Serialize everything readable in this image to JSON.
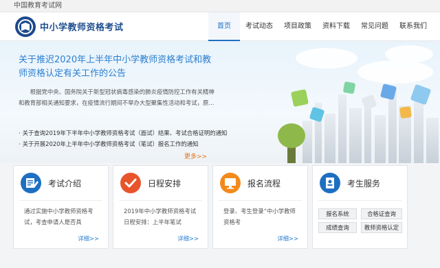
{
  "topbar": {
    "site_name": "中国教育考试网"
  },
  "header": {
    "site_title": "中小学教师资格考试",
    "nav": [
      "首页",
      "考试动态",
      "项目政策",
      "资料下载",
      "常见问题",
      "联系我们"
    ]
  },
  "hero": {
    "title": "关于推迟2020年上半年中小学教师资格考试和教师资格认定有关工作的公告",
    "body": "根据党中央、国务院关于新型冠状病毒感染的肺炎疫情防控工作有关精神和教育部相关通知要求，在疫情流行期间不举办大型聚集性活动和考试，原...",
    "news": [
      "关于查询2019年下半年中小学教师资格考试（面试）结果、考试合格证明的通知",
      "关于开展2020年上半年中小学教师资格考试（笔试）报名工作的通知"
    ],
    "more": "更多>>"
  },
  "cards": [
    {
      "title": "考试介绍",
      "desc": "通过实施中小学教师资格考试，考查申请人是否具",
      "more": "详细>>",
      "icon": "document-edit-icon",
      "color": "#1e6fc2"
    },
    {
      "title": "日程安排",
      "desc": "2019年中小学教师资格考试日程安排：上半年笔试",
      "more": "详细>>",
      "icon": "checkmark-icon",
      "color": "#e8542c"
    },
    {
      "title": "报名流程",
      "desc": "登录、考生登录“中小学教师资格考",
      "more": "详细>>",
      "icon": "monitor-icon",
      "color": "#f28a1e"
    },
    {
      "title": "考生服务",
      "icon": "contact-card-icon",
      "color": "#1e6fc2",
      "buttons": [
        "报名系统",
        "合格证查询",
        "成绩查询",
        "教师资格认定"
      ]
    }
  ]
}
